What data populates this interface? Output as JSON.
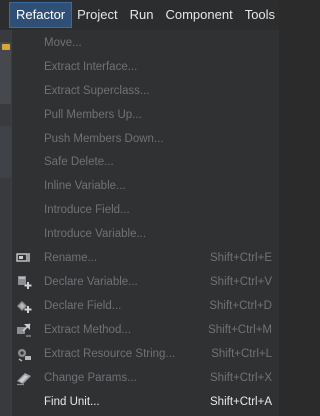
{
  "menubar": {
    "items": [
      {
        "label": "Refactor"
      },
      {
        "label": "Project"
      },
      {
        "label": "Run"
      },
      {
        "label": "Component"
      },
      {
        "label": "Tools"
      }
    ]
  },
  "refactor_menu": {
    "items": [
      {
        "label": "Move...",
        "shortcut": "",
        "enabled": false,
        "icon": ""
      },
      {
        "label": "Extract Interface...",
        "shortcut": "",
        "enabled": false,
        "icon": ""
      },
      {
        "label": "Extract Superclass...",
        "shortcut": "",
        "enabled": false,
        "icon": ""
      },
      {
        "label": "Pull Members Up...",
        "shortcut": "",
        "enabled": false,
        "icon": ""
      },
      {
        "label": "Push Members Down...",
        "shortcut": "",
        "enabled": false,
        "icon": ""
      },
      {
        "label": "Safe Delete...",
        "shortcut": "",
        "enabled": false,
        "icon": ""
      },
      {
        "label": "Inline Variable...",
        "shortcut": "",
        "enabled": false,
        "icon": ""
      },
      {
        "label": "Introduce Field...",
        "shortcut": "",
        "enabled": false,
        "icon": ""
      },
      {
        "label": "Introduce Variable...",
        "shortcut": "",
        "enabled": false,
        "icon": ""
      },
      {
        "label": "Rename...",
        "shortcut": "Shift+Ctrl+E",
        "enabled": false,
        "icon": "rename-icon"
      },
      {
        "label": "Declare Variable...",
        "shortcut": "Shift+Ctrl+V",
        "enabled": false,
        "icon": "declare-variable-icon"
      },
      {
        "label": "Declare Field...",
        "shortcut": "Shift+Ctrl+D",
        "enabled": false,
        "icon": "declare-field-icon"
      },
      {
        "label": "Extract Method...",
        "shortcut": "Shift+Ctrl+M",
        "enabled": false,
        "icon": "extract-method-icon"
      },
      {
        "label": "Extract Resource String...",
        "shortcut": "Shift+Ctrl+L",
        "enabled": false,
        "icon": "extract-resource-string-icon"
      },
      {
        "label": "Change Params...",
        "shortcut": "Shift+Ctrl+X",
        "enabled": false,
        "icon": "change-params-icon"
      },
      {
        "label": "Find Unit...",
        "shortcut": "Shift+Ctrl+A",
        "enabled": true,
        "icon": ""
      }
    ]
  },
  "colors": {
    "active_menu_bg": "#2f4f76",
    "disabled_text": "#6f7377",
    "enabled_text": "#e8e8e8",
    "menu_bg": "#2f3133"
  }
}
